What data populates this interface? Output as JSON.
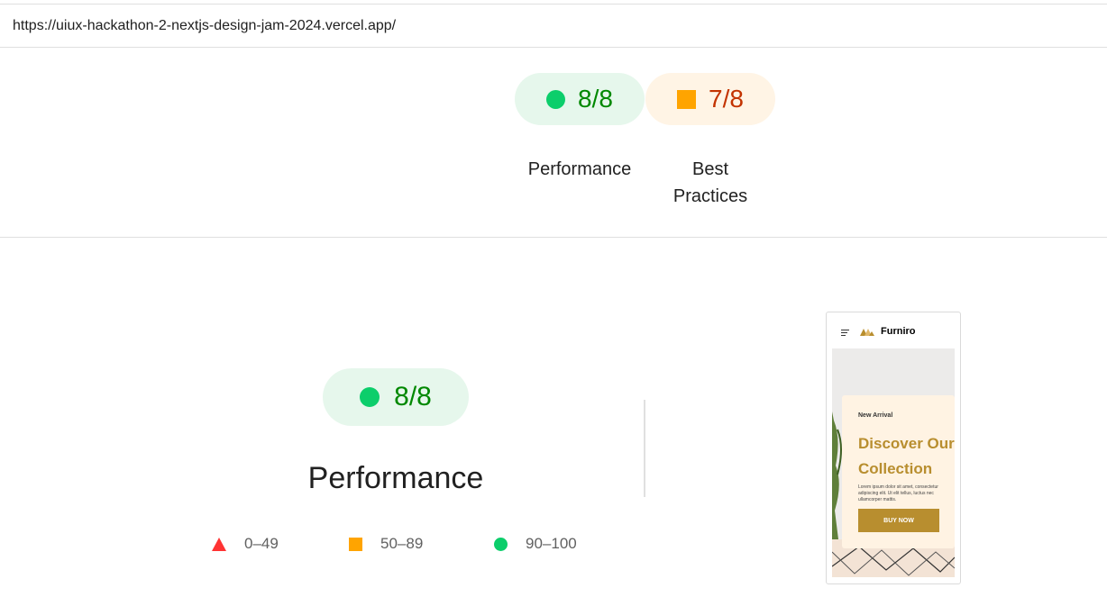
{
  "url": "https://uiux-hackathon-2-nextjs-design-jam-2024.vercel.app/",
  "summary": {
    "categories": [
      {
        "score": "8/8",
        "label": "Performance",
        "status": "pass"
      },
      {
        "score": "7/8",
        "label_line1": "Best",
        "label_line2": "Practices",
        "status": "average"
      }
    ]
  },
  "detail": {
    "score": "8/8",
    "title": "Performance"
  },
  "legend": [
    {
      "shape": "triangle",
      "range": "0–49",
      "color": "#ff3333"
    },
    {
      "shape": "square",
      "range": "50–89",
      "color": "#ffa400"
    },
    {
      "shape": "circle",
      "range": "90–100",
      "color": "#0cce6b"
    }
  ],
  "screenshot": {
    "brand": "Furniro",
    "badge": "New Arrival",
    "headline_line1": "Discover Our",
    "headline_line2": "Collection",
    "body": "Lorem ipsum dolor sit amet, consectetur adipiscing elit. Ut elit tellus, luctus nec ullamcorper mattis.",
    "button": "BUY NOW",
    "accent": "#b88e2f"
  },
  "colors": {
    "pass": "#0cce6b",
    "pass_text": "#008800",
    "average": "#ffa400",
    "average_text": "#c33300",
    "fail": "#ff3333"
  }
}
